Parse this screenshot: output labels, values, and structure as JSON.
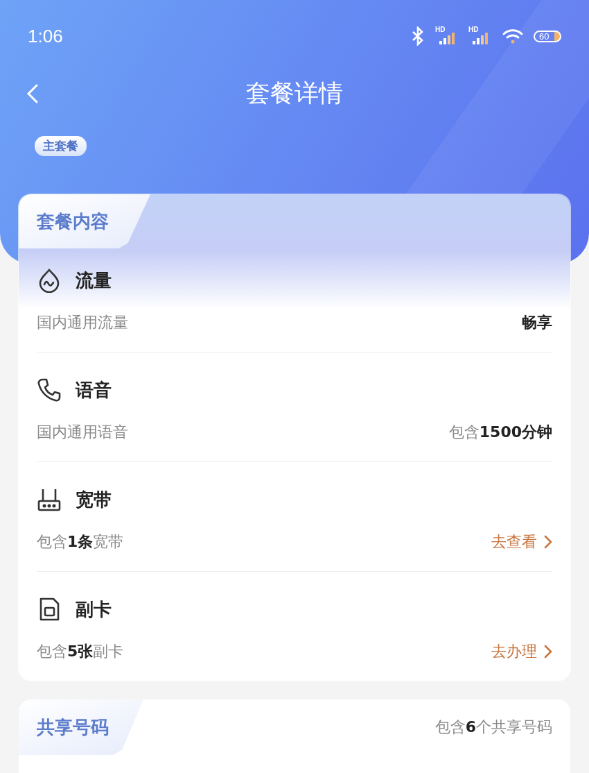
{
  "status_bar": {
    "time": "1:06",
    "networks": [
      {
        "label": "HD"
      },
      {
        "label": "HD"
      }
    ],
    "battery": "60"
  },
  "header": {
    "title": "套餐详情",
    "tag": "主套餐"
  },
  "content_card": {
    "title": "套餐内容",
    "items": [
      {
        "kind": "data",
        "name": "流量",
        "desc": "国内通用流量",
        "value": "畅享"
      },
      {
        "kind": "voice",
        "name": "语音",
        "desc": "国内通用语音",
        "value": "包含**1500分钟**"
      },
      {
        "kind": "broadband",
        "name": "宽带",
        "desc": "包含**1条**宽带",
        "link": "去查看"
      },
      {
        "kind": "sim",
        "name": "副卡",
        "desc": "包含**5张**副卡",
        "link": "去办理"
      }
    ]
  },
  "share_card": {
    "title": "共享号码",
    "summary": "包含**6**个共享号码"
  }
}
